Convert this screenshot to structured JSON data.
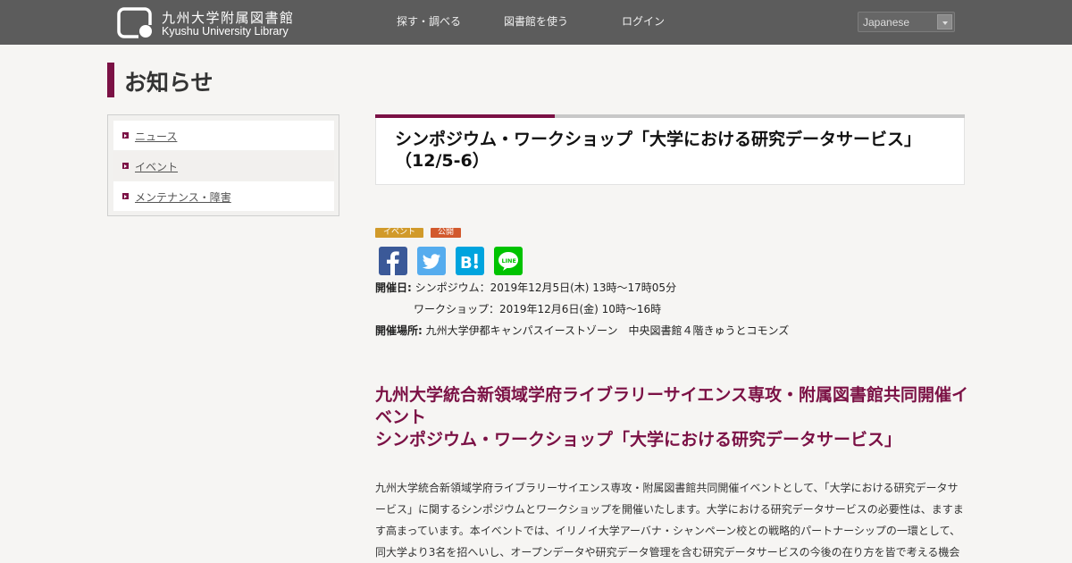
{
  "header": {
    "logo_ja": "九州大学附属図書館",
    "logo_en": "Kyushu University Library",
    "nav": [
      "探す・調べる",
      "図書館を使う",
      "ログイン"
    ],
    "language": "Japanese"
  },
  "page": {
    "title": "お知らせ"
  },
  "sidebar": {
    "items": [
      {
        "label": "ニュース"
      },
      {
        "label": "イベント"
      },
      {
        "label": "メンテナンス・障害"
      }
    ]
  },
  "article": {
    "title": "シンポジウム・ワークショップ「大学における研究データサービス」（12/5-6）",
    "badges": [
      "イベント",
      "公開"
    ],
    "share": [
      "facebook-icon",
      "twitter-icon",
      "hatena-bookmark-icon",
      "line-icon"
    ],
    "date_label": "開催日:",
    "date_symposium": "シンポジウム：2019年12月5日(木) 13時～17時05分",
    "date_workshop": "ワークショップ：2019年12月6日(金) 10時～16時",
    "venue_label": "開催場所:",
    "venue": "九州大学伊都キャンパスイーストゾーン　中央図書館４階きゅうとコモンズ",
    "heading_line1": "九州大学統合新領域学府ライブラリーサイエンス専攻・附属図書館共同開催イベント",
    "heading_line2": "シンポジウム・ワークショップ「大学における研究データサービス」",
    "body": "九州大学統合新領域学府ライブラリーサイエンス専攻・附属図書館共同開催イベントとして、「大学における研究データサービス」に関するシンポジウムとワークショップを開催いたします。大学における研究データサービスの必要性は、ますます高まっています。本イベントでは、イリノイ大学アーバナ・シャンペーン校との戦略的パートナーシップの一環として、同大学より3名を招へいし、オープンデータや研究データ管理を含む研究データサービスの今後の在り方を皆で考える機会"
  },
  "colors": {
    "accent": "#7b1145",
    "header_bg": "#5c5c5c",
    "badge_event": "#d19a2a",
    "badge_public": "#d2592d"
  }
}
